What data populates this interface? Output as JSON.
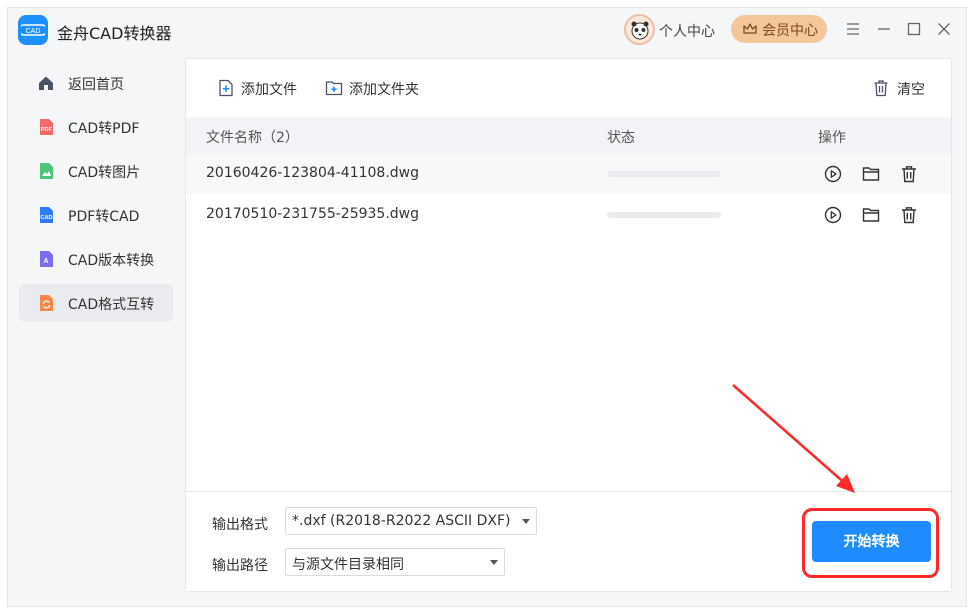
{
  "app": {
    "title": "金舟CAD转换器",
    "logo_icon": "cad-logo-icon",
    "brand_color": "#1e90ff"
  },
  "header": {
    "personal_center": "个人中心",
    "vip_center": "会员中心"
  },
  "sidebar": {
    "items": [
      {
        "label": "返回首页",
        "icon": "home-icon",
        "active": false
      },
      {
        "label": "CAD转PDF",
        "icon": "pdf-file-icon",
        "active": false
      },
      {
        "label": "CAD转图片",
        "icon": "image-file-icon",
        "active": false
      },
      {
        "label": "PDF转CAD",
        "icon": "cad-file-icon",
        "active": false
      },
      {
        "label": "CAD版本转换",
        "icon": "version-file-icon",
        "active": false
      },
      {
        "label": "CAD格式互转",
        "icon": "format-convert-icon",
        "active": true
      }
    ]
  },
  "toolbar": {
    "add_file": "添加文件",
    "add_folder": "添加文件夹",
    "clear": "清空"
  },
  "table": {
    "headers": {
      "name": "文件名称（2）",
      "status": "状态",
      "actions": "操作"
    },
    "rows": [
      {
        "name": "20160426-123804-41108.dwg",
        "progress": 0
      },
      {
        "name": "20170510-231755-25935.dwg",
        "progress": 0
      }
    ]
  },
  "output": {
    "format_label": "输出格式",
    "format_value": "*.dxf (R2018-R2022 ASCII DXF)",
    "path_label": "输出路径",
    "path_value": "与源文件目录相同"
  },
  "start_button": "开始转换",
  "colors": {
    "accent": "#1e8cff",
    "highlight": "#ff2a2a",
    "vip": "#f3c79a"
  }
}
